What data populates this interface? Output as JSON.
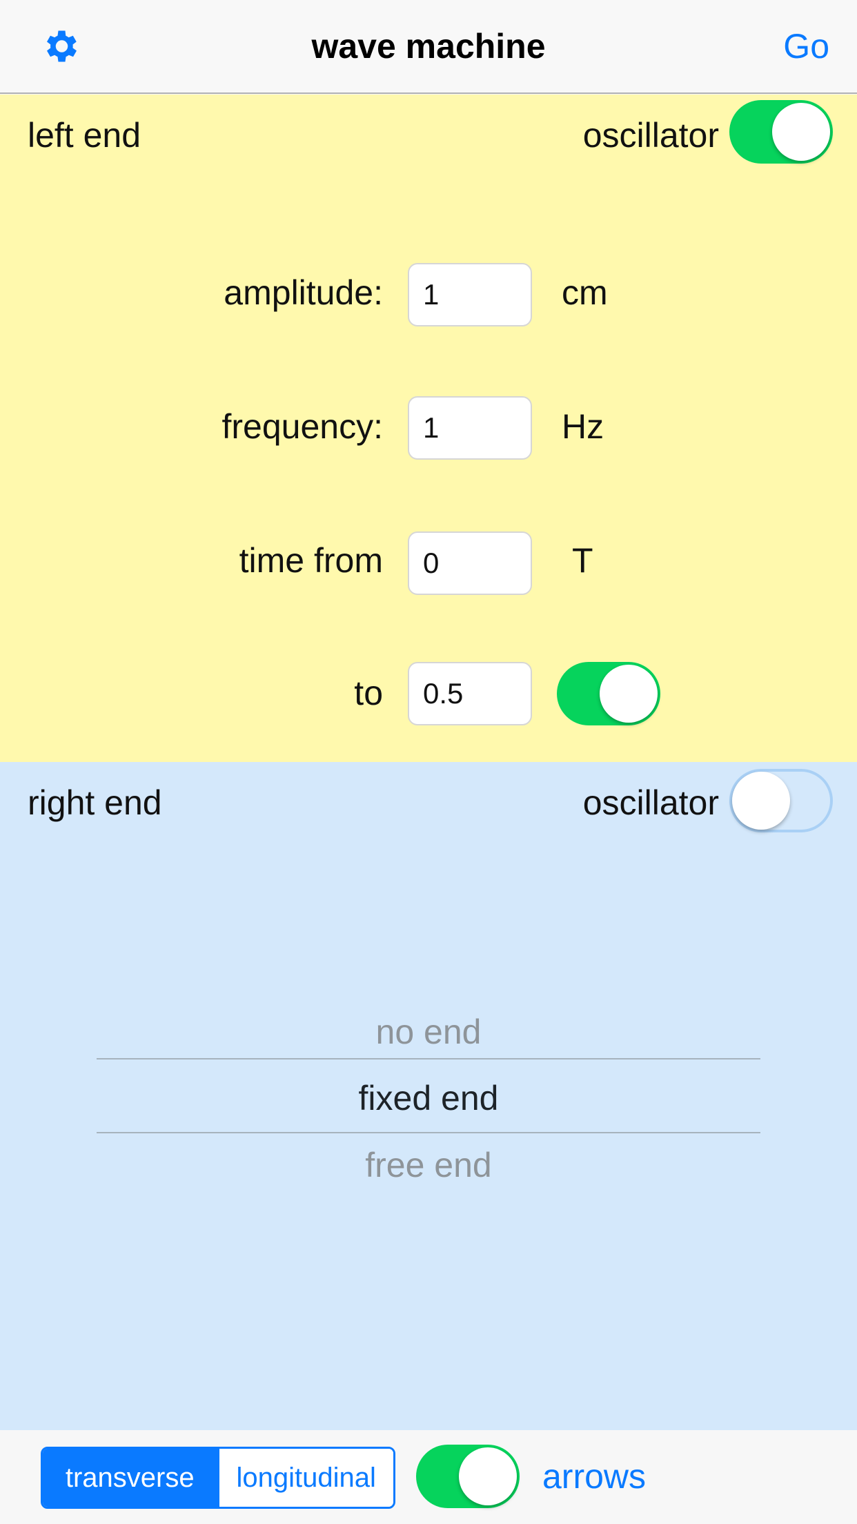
{
  "navbar": {
    "settings_icon": "gear-icon",
    "title": "wave machine",
    "go_label": "Go"
  },
  "left_end": {
    "title": "left end",
    "oscillator_label": "oscillator",
    "oscillator_on": true,
    "fields": {
      "amplitude": {
        "label": "amplitude:",
        "value": "1",
        "unit": "cm"
      },
      "frequency": {
        "label": "frequency:",
        "value": "1",
        "unit": "Hz"
      },
      "time_from": {
        "label": "time from",
        "value": "0",
        "unit": "T"
      },
      "time_to": {
        "label": "to",
        "value": "0.5",
        "toggle_on": true
      }
    }
  },
  "right_end": {
    "title": "right end",
    "oscillator_label": "oscillator",
    "oscillator_on": false,
    "picker": {
      "options": [
        "no end",
        "fixed end",
        "free end"
      ],
      "selected": "fixed end"
    }
  },
  "bottombar": {
    "segments": [
      "transverse",
      "longitudinal"
    ],
    "selected_segment": "transverse",
    "arrows_on": true,
    "arrows_label": "arrows"
  },
  "colors": {
    "accent": "#0a7aff",
    "switch_on": "#06d35c",
    "left_bg": "#fff9ad",
    "right_bg": "#d4e8fb"
  }
}
